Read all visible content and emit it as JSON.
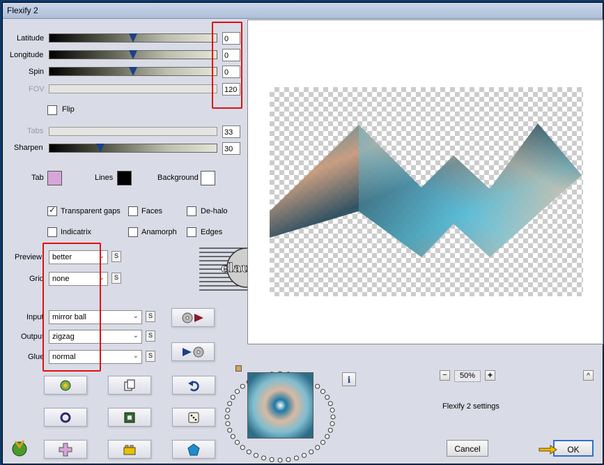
{
  "window": {
    "title": "Flexify 2"
  },
  "sliders": [
    {
      "name": "latitude",
      "label": "Latitude",
      "value": "0",
      "level": 0.5,
      "enabled": true
    },
    {
      "name": "longitude",
      "label": "Longitude",
      "value": "0",
      "level": 0.5,
      "enabled": true
    },
    {
      "name": "spin",
      "label": "Spin",
      "value": "0",
      "level": 0.5,
      "enabled": true
    },
    {
      "name": "fov",
      "label": "FOV",
      "value": "120",
      "level": null,
      "enabled": false
    },
    {
      "name": "tabs",
      "label": "Tabs",
      "value": "33",
      "level": null,
      "enabled": false
    },
    {
      "name": "sharpen",
      "label": "Sharpen",
      "value": "30",
      "level": 0.3,
      "enabled": true
    }
  ],
  "flip": {
    "label": "Flip",
    "checked": false
  },
  "colors": {
    "tab": {
      "label": "Tab",
      "color": "#d7a6d9"
    },
    "lines": {
      "label": "Lines",
      "color": "#000000"
    },
    "background": {
      "label": "Background",
      "color": "#ffffff"
    }
  },
  "options": {
    "transparent_gaps": {
      "label": "Transparent gaps",
      "checked": true
    },
    "faces": {
      "label": "Faces",
      "checked": false
    },
    "de_halo": {
      "label": "De-halo",
      "checked": false
    },
    "indicatrix": {
      "label": "Indicatrix",
      "checked": false
    },
    "anamorph": {
      "label": "Anamorph",
      "checked": false
    },
    "edges": {
      "label": "Edges",
      "checked": false
    }
  },
  "dropdowns": {
    "preview": {
      "label": "Preview",
      "value": "better"
    },
    "grid": {
      "label": "Grid",
      "value": "none"
    },
    "input": {
      "label": "Input",
      "value": "mirror ball"
    },
    "output": {
      "label": "Output",
      "value": "zigzag"
    },
    "glue": {
      "label": "Glue",
      "value": "normal"
    }
  },
  "s_label": "S",
  "watermark": {
    "text": "claudia"
  },
  "zoom": {
    "minus": "−",
    "value": "50%",
    "plus": "+"
  },
  "settings_name": "Flexify 2 settings",
  "info_label": "i",
  "scroll_up": "^",
  "buttons": {
    "cancel": "Cancel",
    "ok": "OK"
  },
  "accent": {
    "highlight": "#e01010",
    "window_bg": "#d9dce6"
  }
}
